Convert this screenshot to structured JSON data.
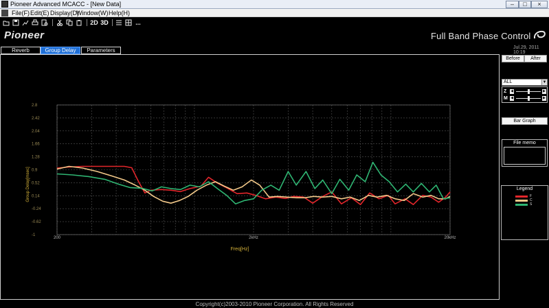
{
  "window": {
    "title": "Pioneer Advanced MCACC - [New Data]",
    "minimize_glyph": "–",
    "maximize_glyph": "□",
    "close_glyph": "×"
  },
  "menu": [
    "File(F)",
    "Edit(E)",
    "Display(D)",
    "Window(W)",
    "Help(H)"
  ],
  "toolbar": {
    "view_2d": "2D",
    "view_3d": "3D",
    "more": "..."
  },
  "brand": {
    "logo": "Pioneer",
    "product_title": "Full Band Phase Control",
    "timestamp": "Jul.29, 2011 10:19"
  },
  "tabs": [
    {
      "label": "Reverb",
      "active": false
    },
    {
      "label": "Group Delay",
      "active": true
    },
    {
      "label": "Parameters",
      "active": false
    }
  ],
  "side": {
    "before_label": "Before",
    "after_label": "After",
    "channel_value": "ALL",
    "dropdown_arrow": "▼",
    "zoom_z_label": "Z",
    "zoom_m_label": "M",
    "arrow_left": "◀",
    "arrow_right": "▶",
    "bar_graph_label": "Bar Graph",
    "file_memo_label": "File memo",
    "legend_title": "Legend",
    "legend": [
      {
        "name": "F",
        "color": "#e3262b"
      },
      {
        "name": "C",
        "color": "#f3c98a"
      },
      {
        "name": "S",
        "color": "#2fb673"
      }
    ]
  },
  "footer": {
    "copyright": "Copyright(c)2003-2010 Pioneer Corporation. All Rights Reserved"
  },
  "chart_data": {
    "type": "line",
    "title": "",
    "xlabel": "Freq[Hz]",
    "ylabel": "Group Delay[msec]",
    "x_scale": "log",
    "xlim": [
      200,
      20000
    ],
    "ylim": [
      -1.0,
      2.8
    ],
    "x_ticks": [
      {
        "value": 200,
        "label": "200"
      },
      {
        "value": 2000,
        "label": "2kHz"
      },
      {
        "value": 20000,
        "label": "20kHz"
      }
    ],
    "y_ticks": [
      2.8,
      2.42,
      2.04,
      1.66,
      1.28,
      0.9,
      0.52,
      0.14,
      -0.24,
      -0.62,
      -1.0
    ],
    "grid": true,
    "series": [
      {
        "name": "F",
        "color": "#e3262b",
        "points": [
          [
            200,
            0.95
          ],
          [
            230,
            0.98
          ],
          [
            270,
            1.0
          ],
          [
            320,
            1.0
          ],
          [
            380,
            1.0
          ],
          [
            440,
            1.0
          ],
          [
            480,
            0.96
          ],
          [
            520,
            0.55
          ],
          [
            560,
            0.22
          ],
          [
            600,
            0.3
          ],
          [
            680,
            0.32
          ],
          [
            760,
            0.3
          ],
          [
            850,
            0.26
          ],
          [
            950,
            0.35
          ],
          [
            1080,
            0.42
          ],
          [
            1180,
            0.68
          ],
          [
            1300,
            0.52
          ],
          [
            1450,
            0.38
          ],
          [
            1650,
            0.2
          ],
          [
            1850,
            0.22
          ],
          [
            2050,
            0.15
          ],
          [
            2300,
            0.05
          ],
          [
            2600,
            0.1
          ],
          [
            2900,
            0.06
          ],
          [
            3200,
            0.12
          ],
          [
            3600,
            0.1
          ],
          [
            4000,
            -0.08
          ],
          [
            4500,
            0.12
          ],
          [
            5000,
            0.25
          ],
          [
            5600,
            -0.1
          ],
          [
            6300,
            0.08
          ],
          [
            7000,
            -0.12
          ],
          [
            7800,
            0.22
          ],
          [
            8700,
            0.05
          ],
          [
            9700,
            0.15
          ],
          [
            10500,
            -0.1
          ],
          [
            11800,
            0.05
          ],
          [
            13000,
            -0.12
          ],
          [
            14500,
            0.15
          ],
          [
            16000,
            0.1
          ],
          [
            17500,
            -0.05
          ],
          [
            19000,
            0.1
          ],
          [
            20000,
            0.25
          ]
        ]
      },
      {
        "name": "C",
        "color": "#f3c98a",
        "points": [
          [
            200,
            0.92
          ],
          [
            230,
            1.0
          ],
          [
            270,
            0.95
          ],
          [
            320,
            0.85
          ],
          [
            380,
            0.72
          ],
          [
            440,
            0.6
          ],
          [
            500,
            0.45
          ],
          [
            560,
            0.3
          ],
          [
            620,
            0.12
          ],
          [
            690,
            -0.02
          ],
          [
            760,
            -0.08
          ],
          [
            840,
            0.0
          ],
          [
            930,
            0.12
          ],
          [
            1030,
            0.3
          ],
          [
            1150,
            0.45
          ],
          [
            1280,
            0.55
          ],
          [
            1420,
            0.42
          ],
          [
            1580,
            0.3
          ],
          [
            1750,
            0.4
          ],
          [
            1950,
            0.6
          ],
          [
            2150,
            0.45
          ],
          [
            2400,
            0.1
          ],
          [
            2650,
            0.12
          ],
          [
            2950,
            0.1
          ],
          [
            3300,
            0.08
          ],
          [
            3650,
            0.08
          ],
          [
            4050,
            0.12
          ],
          [
            4500,
            0.1
          ],
          [
            5000,
            0.12
          ],
          [
            5600,
            0.05
          ],
          [
            6200,
            0.1
          ],
          [
            6900,
            0.0
          ],
          [
            7700,
            0.15
          ],
          [
            8500,
            0.1
          ],
          [
            9500,
            0.15
          ],
          [
            10500,
            0.05
          ],
          [
            11700,
            0.0
          ],
          [
            13000,
            0.2
          ],
          [
            14500,
            0.1
          ],
          [
            16000,
            0.15
          ],
          [
            17500,
            0.05
          ],
          [
            19000,
            0.05
          ],
          [
            20000,
            0.12
          ]
        ]
      },
      {
        "name": "S",
        "color": "#2fb673",
        "points": [
          [
            200,
            0.78
          ],
          [
            240,
            0.75
          ],
          [
            290,
            0.7
          ],
          [
            350,
            0.62
          ],
          [
            410,
            0.48
          ],
          [
            470,
            0.38
          ],
          [
            540,
            0.36
          ],
          [
            610,
            0.28
          ],
          [
            680,
            0.4
          ],
          [
            760,
            0.35
          ],
          [
            850,
            0.32
          ],
          [
            950,
            0.45
          ],
          [
            1060,
            0.4
          ],
          [
            1180,
            0.55
          ],
          [
            1310,
            0.35
          ],
          [
            1460,
            0.15
          ],
          [
            1620,
            -0.1
          ],
          [
            1800,
            0.0
          ],
          [
            2000,
            0.05
          ],
          [
            2200,
            0.3
          ],
          [
            2450,
            0.45
          ],
          [
            2700,
            0.3
          ],
          [
            3000,
            0.85
          ],
          [
            3300,
            0.45
          ],
          [
            3700,
            0.85
          ],
          [
            4100,
            0.35
          ],
          [
            4500,
            0.6
          ],
          [
            5000,
            0.2
          ],
          [
            5500,
            0.62
          ],
          [
            6100,
            0.3
          ],
          [
            6700,
            0.75
          ],
          [
            7400,
            0.55
          ],
          [
            8100,
            1.12
          ],
          [
            8900,
            0.75
          ],
          [
            9800,
            0.55
          ],
          [
            10800,
            0.25
          ],
          [
            11900,
            0.48
          ],
          [
            13000,
            0.25
          ],
          [
            14300,
            0.5
          ],
          [
            15700,
            0.25
          ],
          [
            17000,
            0.45
          ],
          [
            18500,
            0.05
          ],
          [
            20000,
            0.08
          ]
        ]
      }
    ]
  }
}
